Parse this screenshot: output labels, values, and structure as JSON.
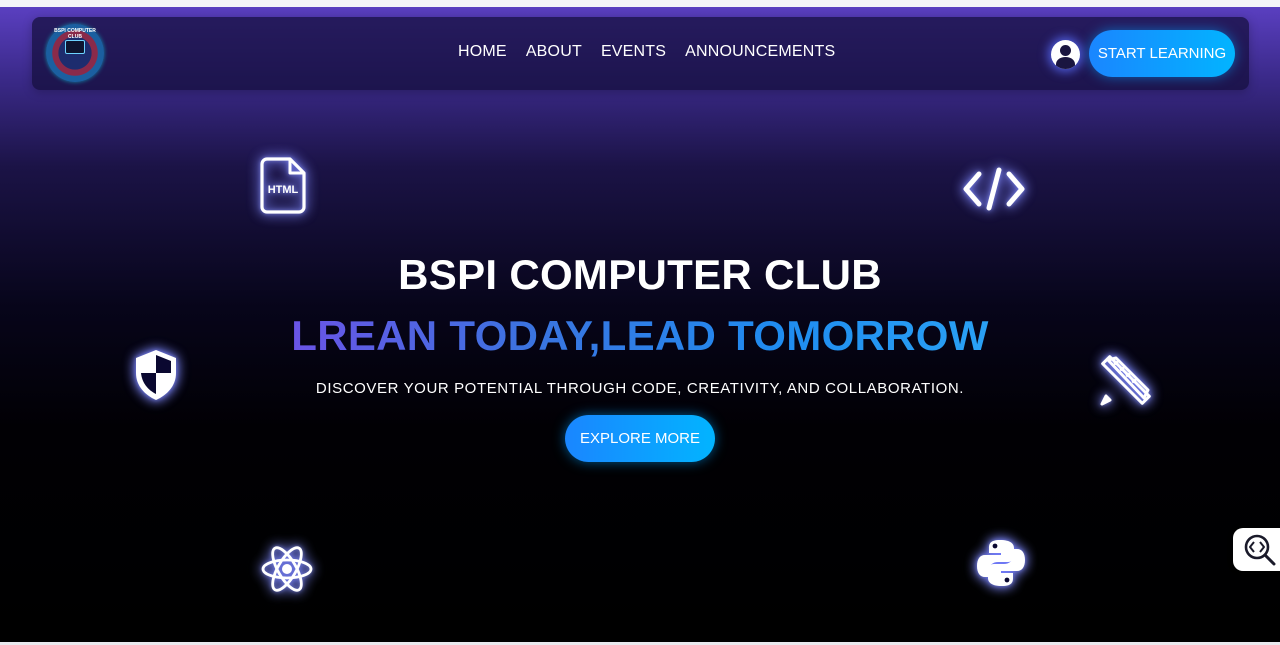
{
  "nav": {
    "logo_text": "BSPI COMPUTER CLUB",
    "links": [
      "HOME",
      "ABOUT",
      "EVENTS",
      "ANNOUNCEMENTS"
    ],
    "cta_label": "START LEARNING"
  },
  "hero": {
    "title": "BSPI COMPUTER CLUB",
    "tagline": "LREAN TODAY,LEAD TOMORROW",
    "subtitle": "DISCOVER YOUR POTENTIAL THROUGH CODE, CREATIVITY, AND COLLABORATION.",
    "cta_label": "EXPLORE MORE"
  },
  "floating_icons": {
    "html_label": "HTML",
    "names": [
      "html-file-icon",
      "code-icon",
      "shield-icon",
      "pencil-ruler-icon",
      "atom-icon",
      "python-icon"
    ]
  },
  "colors": {
    "accent": "#0aa0ff",
    "nav_bg": "#140e3a",
    "gradient_top": "#5a3fc0",
    "page_bottom": "#000000",
    "tagline_start": "#6a54e6",
    "tagline_end": "#2aa1f4"
  }
}
